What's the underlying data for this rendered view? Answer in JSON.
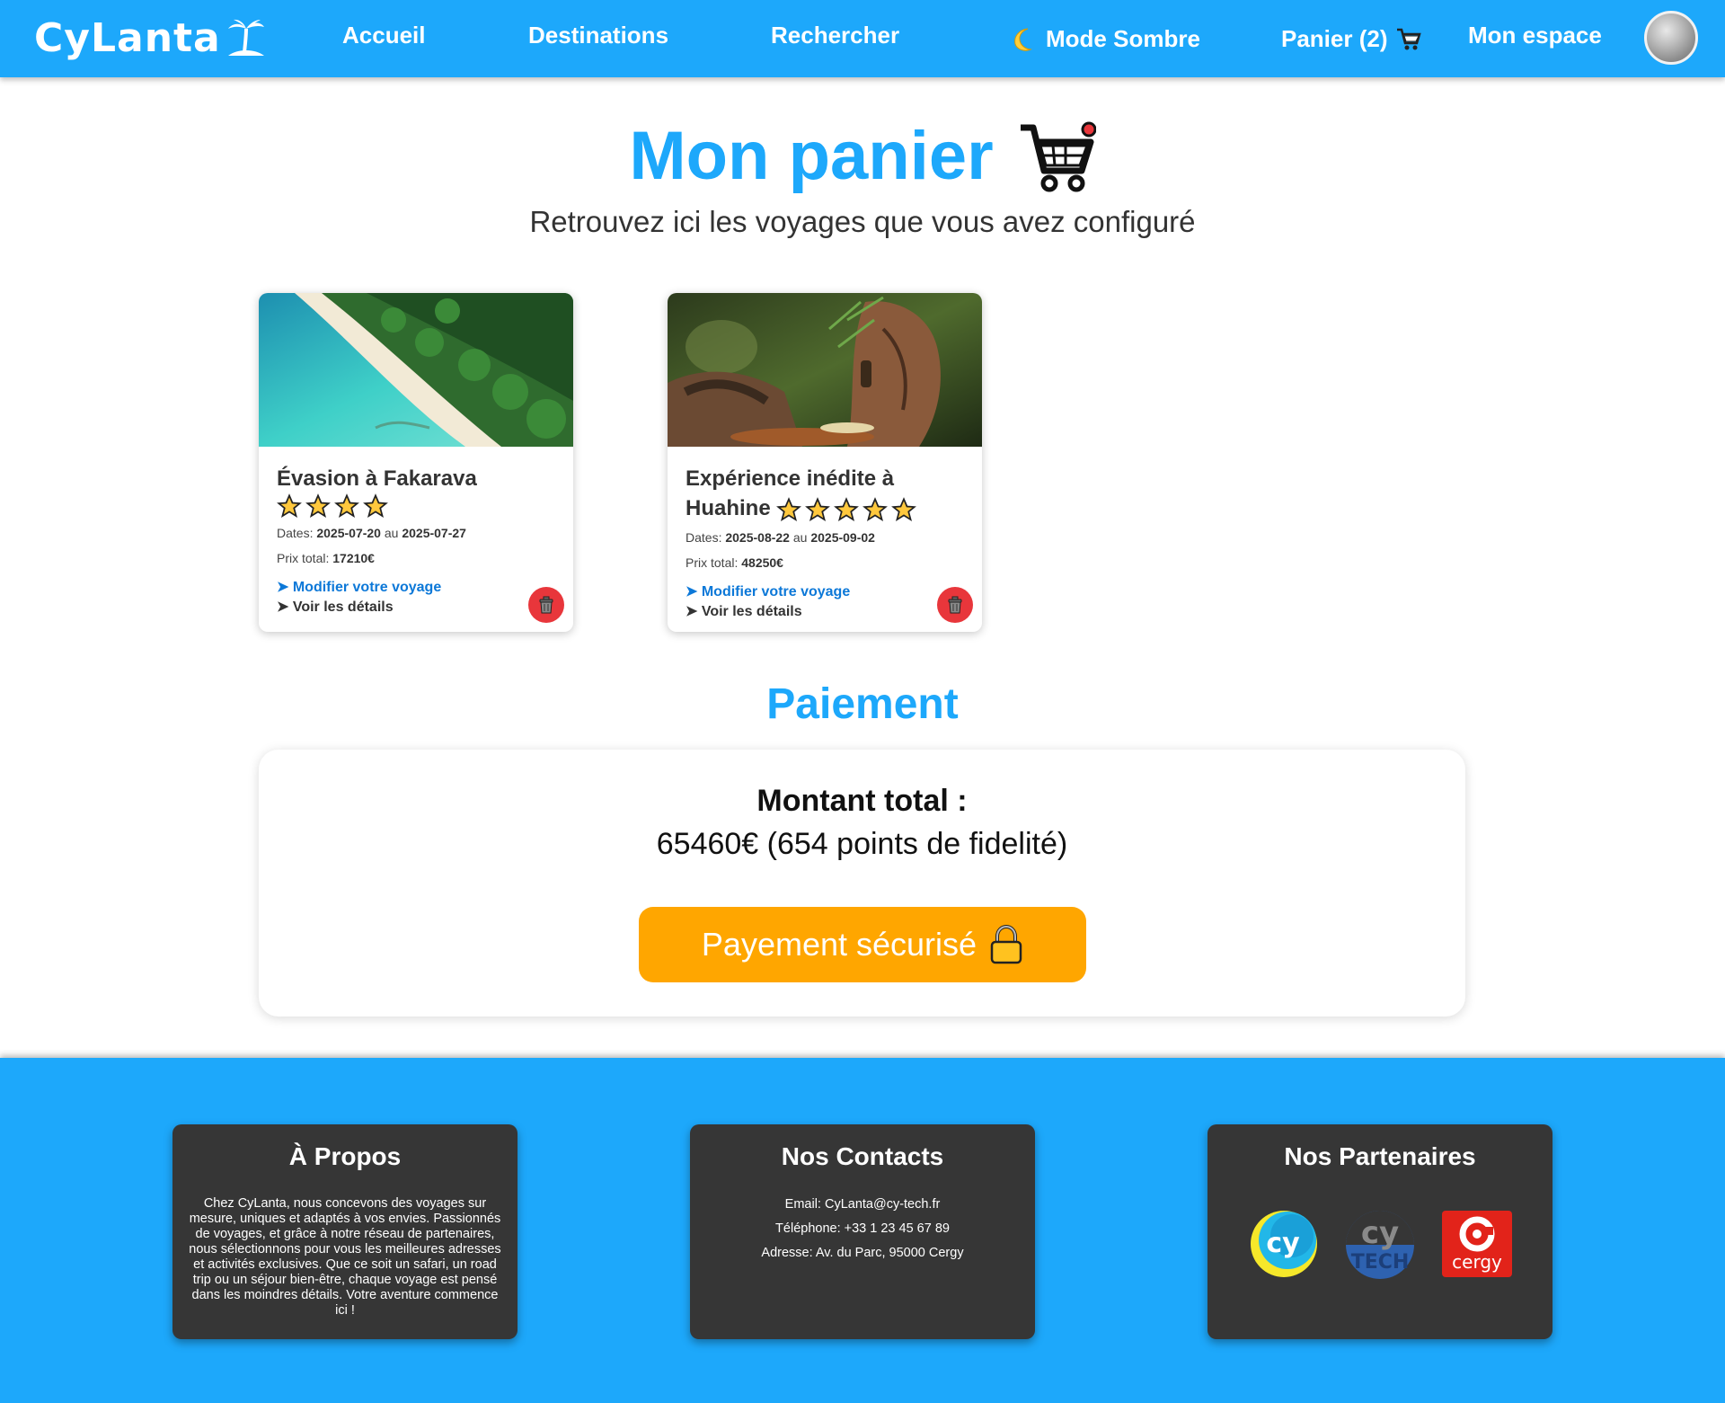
{
  "navbar": {
    "brand": "CyLanta",
    "links": {
      "home": "Accueil",
      "destinations": "Destinations",
      "search": "Rechercher",
      "dark_mode": "Mode Sombre",
      "cart": "Panier (2)",
      "account": "Mon espace"
    }
  },
  "header": {
    "title": "Mon panier",
    "subtitle": "Retrouvez ici les voyages que vous avez configuré"
  },
  "cart": {
    "items": [
      {
        "title": "Évasion à Fakarava",
        "stars": 4,
        "dates_label": "Dates:",
        "date_start": "2025-07-20",
        "date_sep": "au",
        "date_end": "2025-07-27",
        "price_label": "Prix total:",
        "price": "17210€",
        "modify": "➤ Modifier votre voyage",
        "details": "➤ Voir les détails"
      },
      {
        "title": "Expérience inédite à Huahine",
        "stars": 5,
        "dates_label": "Dates:",
        "date_start": "2025-08-22",
        "date_sep": "au",
        "date_end": "2025-09-02",
        "price_label": "Prix total:",
        "price": "48250€",
        "modify": "➤ Modifier votre voyage",
        "details": "➤ Voir les détails"
      }
    ]
  },
  "payment": {
    "heading": "Paiement",
    "total_label": "Montant total :",
    "total_value": "65460€ (654 points de fidelité)",
    "button": "Payement sécurisé"
  },
  "footer": {
    "about": {
      "title": "À Propos",
      "text": "Chez CyLanta, nous concevons des voyages sur mesure, uniques et adaptés à vos envies. Passionnés de voyages, et grâce à notre réseau de partenaires, nous sélectionnons pour vous les meilleures adresses et activités exclusives. Que ce soit un safari, un road trip ou un séjour bien-être, chaque voyage est pensé dans les moindres détails. Votre aventure commence ici !"
    },
    "contacts": {
      "title": "Nos Contacts",
      "email": "Email: CyLanta@cy-tech.fr",
      "phone": "Téléphone: +33 1 23 45 67 89",
      "address": "Adresse: Av. du Parc, 95000 Cergy"
    },
    "partners": {
      "title": "Nos Partenaires",
      "logos": [
        "cy",
        "TECH",
        "cergy"
      ]
    }
  },
  "colors": {
    "primary": "#1da8fb",
    "accent": "#ffa600",
    "danger": "#e8363b",
    "link": "#0c78d8",
    "footer_box": "#363636"
  },
  "icons": [
    "palm-island-icon",
    "moon-icon",
    "cart-icon",
    "avatar",
    "star-icon",
    "trash-icon",
    "lock-icon"
  ]
}
